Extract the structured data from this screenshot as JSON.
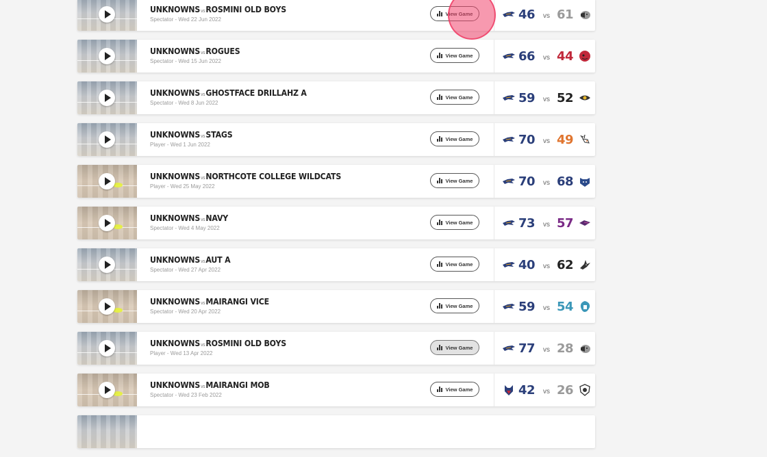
{
  "games": [
    {
      "home": "UNKNOWNS",
      "vs": "vs",
      "away": "ROSMINI OLD BOYS",
      "meta": "Spectator - Wed 22 Jun 2022",
      "btn": "View Game",
      "home_score": "46",
      "away_score": "61",
      "home_color": "#2b3f7a",
      "away_color": "#9a9a9a",
      "versus": "vs",
      "home_logo": "hawk-icon",
      "away_logo": "badger-icon",
      "thumb": "cool"
    },
    {
      "home": "UNKNOWNS",
      "vs": "vs",
      "away": "ROGUES",
      "meta": "Spectator - Wed 15 Jun 2022",
      "btn": "View Game",
      "home_score": "66",
      "away_score": "44",
      "home_color": "#2b3f7a",
      "away_color": "#c0283a",
      "versus": "vs",
      "home_logo": "hawk-icon",
      "away_logo": "rogue-head-icon",
      "thumb": "cool"
    },
    {
      "home": "UNKNOWNS",
      "vs": "vs",
      "away": "GHOSTFACE DRILLAHZ A",
      "meta": "Spectator - Wed 8 Jun 2022",
      "btn": "View Game",
      "home_score": "59",
      "away_score": "52",
      "home_color": "#2b3f7a",
      "away_color": "#222222",
      "versus": "vs",
      "home_logo": "hawk-icon",
      "away_logo": "eye-icon",
      "thumb": "cool"
    },
    {
      "home": "UNKNOWNS",
      "vs": "vs",
      "away": "STAGS",
      "meta": "Player - Wed 1 Jun 2022",
      "btn": "View Game",
      "home_score": "70",
      "away_score": "49",
      "home_color": "#2b3f7a",
      "away_color": "#e0752f",
      "versus": "vs",
      "home_logo": "hawk-icon",
      "away_logo": "stag-icon",
      "thumb": "cool"
    },
    {
      "home": "UNKNOWNS",
      "vs": "vs",
      "away": "NORTHCOTE COLLEGE WILDCATS",
      "meta": "Player - Wed 25 May 2022",
      "btn": "View Game",
      "home_score": "70",
      "away_score": "68",
      "home_color": "#2b3f7a",
      "away_color": "#2b3f7a",
      "versus": "vs",
      "home_logo": "hawk-icon",
      "away_logo": "wildcat-icon",
      "thumb": "warm"
    },
    {
      "home": "UNKNOWNS",
      "vs": "vs",
      "away": "NAVY",
      "meta": "Spectator - Wed 4 May 2022",
      "btn": "View Game",
      "home_score": "73",
      "away_score": "57",
      "home_color": "#2b3f7a",
      "away_color": "#7a2a86",
      "versus": "vs",
      "home_logo": "hawk-icon",
      "away_logo": "navy-fish-icon",
      "thumb": "warm"
    },
    {
      "home": "UNKNOWNS",
      "vs": "vs",
      "away": "AUT A",
      "meta": "Spectator - Wed 27 Apr 2022",
      "btn": "View Game",
      "home_score": "40",
      "away_score": "62",
      "home_color": "#2b3f7a",
      "away_color": "#222222",
      "versus": "vs",
      "home_logo": "hawk-icon",
      "away_logo": "shark-icon",
      "thumb": "cool"
    },
    {
      "home": "UNKNOWNS",
      "vs": "vs",
      "away": "MAIRANGI VICE",
      "meta": "Spectator - Wed 20 Apr 2022",
      "btn": "View Game",
      "home_score": "59",
      "away_score": "54",
      "home_color": "#2b3f7a",
      "away_color": "#3b97b8",
      "versus": "vs",
      "home_logo": "hawk-icon",
      "away_logo": "spartan-icon",
      "thumb": "warm"
    },
    {
      "home": "UNKNOWNS",
      "vs": "vs",
      "away": "ROSMINI OLD BOYS",
      "meta": "Player - Wed 13 Apr 2022",
      "btn": "View Game",
      "home_score": "77",
      "away_score": "28",
      "home_color": "#2b3f7a",
      "away_color": "#9a9a9a",
      "versus": "vs",
      "home_logo": "hawk-icon",
      "away_logo": "badger-icon",
      "thumb": "cool"
    },
    {
      "home": "UNKNOWNS",
      "vs": "vs",
      "away": "MAIRANGI MOB",
      "meta": "Spectator - Wed 23 Feb 2022",
      "btn": "View Game",
      "home_score": "42",
      "away_score": "26",
      "home_color": "#2b3f7a",
      "away_color": "#9a9a9a",
      "versus": "vs",
      "home_logo": "wolf-head-icon",
      "away_logo": "skull-shield-icon",
      "thumb": "warm"
    }
  ],
  "pressed_index": 8,
  "highlight_index": 0
}
